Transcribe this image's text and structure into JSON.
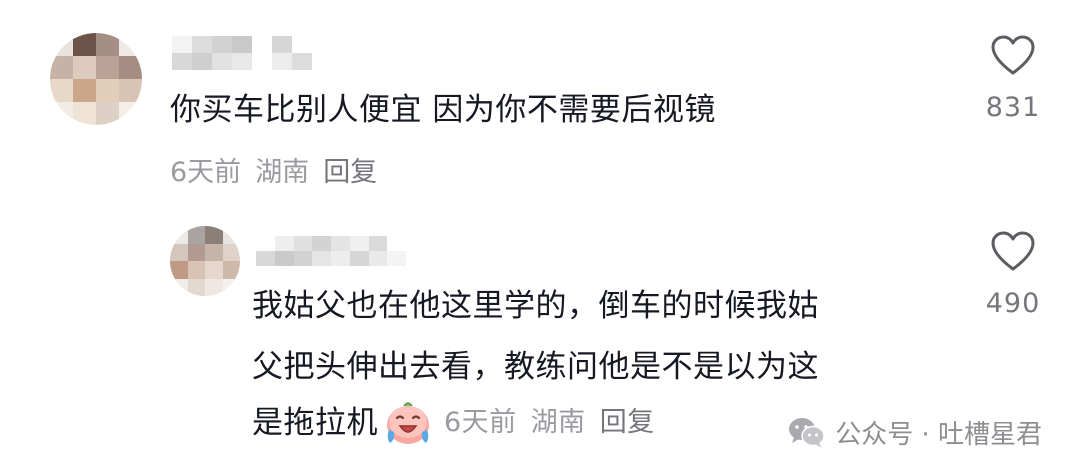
{
  "comments": [
    {
      "text": "你买车比别人便宜  因为你不需要后视镜",
      "time": "6天前",
      "location": "湖南",
      "reply_label": "回复",
      "likes": "831"
    }
  ],
  "reply": {
    "lines": [
      "我姑父也在他这里学的，倒车的时候我姑",
      "父把头伸出去看，教练问他是不是以为这",
      "是拖拉机"
    ],
    "emoji": "crying-laugh-emoji",
    "time": "6天前",
    "location": "湖南",
    "reply_label": "回复",
    "likes": "490"
  },
  "watermark": {
    "text": "公众号 · 吐槽星君",
    "icon": "wechat-icon"
  },
  "colors": {
    "text_primary": "#161823",
    "text_meta": "#9a9ba0",
    "heart_outline": "#5c5d62"
  }
}
